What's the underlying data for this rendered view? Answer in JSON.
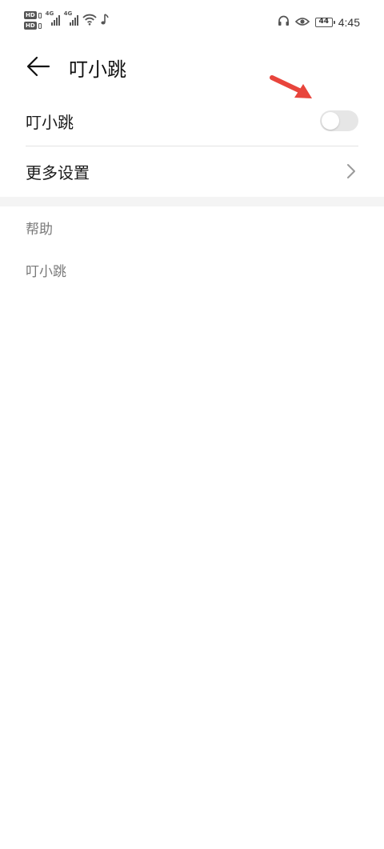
{
  "status_bar": {
    "left_badges": [
      "HD",
      "HD"
    ],
    "network_1": "4G",
    "network_2": "4G",
    "battery_level": "44",
    "time": "4:45",
    "icons": [
      "hd-icon",
      "signal-icon",
      "wifi-icon",
      "music-note-icon",
      "headphones-icon",
      "eye-icon",
      "battery-icon"
    ]
  },
  "header": {
    "back_icon": "arrow-left-icon",
    "title": "叮小跳"
  },
  "settings": {
    "toggle_row": {
      "label": "叮小跳",
      "enabled": false
    },
    "more_row": {
      "label": "更多设置",
      "icon": "chevron-right-icon"
    }
  },
  "help": {
    "section_title": "帮助",
    "link": "叮小跳"
  },
  "colors": {
    "annotation_arrow": "#e8453c",
    "toggle_off_track": "#e6e6e6",
    "secondary_text": "#7a7a7a",
    "divider": "#e3e3e3"
  }
}
